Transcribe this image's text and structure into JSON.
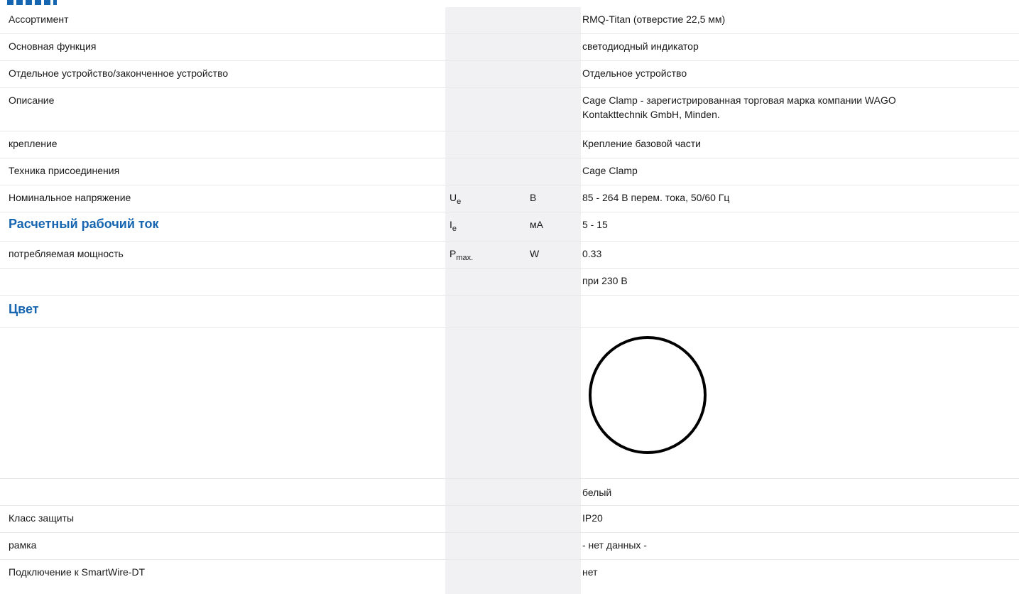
{
  "rows": [
    {
      "label": "Ассортимент",
      "value": "RMQ-Titan (отверстие 22,5 мм)"
    },
    {
      "label": "Основная функция",
      "value": "светодиодный индикатор"
    },
    {
      "label": "Отдельное устройство/законченное устройство",
      "value": "Отдельное устройство"
    },
    {
      "label": "Описание",
      "value_line1": "Cage Clamp - зарегистрированная торговая марка компании WAGO",
      "value_line2": "Kontakttechnik GmbH, Minden."
    },
    {
      "label": "крепление",
      "value": "Крепление базовой части"
    },
    {
      "label": "Техника присоединения",
      "value": "Cage Clamp"
    },
    {
      "label": "Номинальное напряжение",
      "symbol": "U",
      "symbol_sub": "e",
      "unit": "В",
      "value": "85 - 264 В перем. тока, 50/60 Гц"
    },
    {
      "label": "Расчетный рабочий ток",
      "symbol": "I",
      "symbol_sub": "e",
      "unit": "мА",
      "value": "5 - 15"
    },
    {
      "label": "потребляемая мощность",
      "symbol": "P",
      "symbol_sub": "max.",
      "unit": "W",
      "value": "0.33"
    },
    {
      "label": "",
      "value": "при 230 В"
    },
    {
      "label": "Цвет",
      "value": ""
    },
    {
      "label": "",
      "value": "",
      "icon": "color-circle-icon"
    },
    {
      "label": "",
      "value": "белый"
    },
    {
      "label": "Класс защиты",
      "value": "IP20"
    },
    {
      "label": "рамка",
      "value": "- нет данных -"
    },
    {
      "label": "Подключение к SmartWire-DT",
      "value": "нет"
    }
  ],
  "colors": {
    "heading": "#1565b0",
    "gray_column": "#f1f1f3",
    "divider": "#e8e8ea",
    "text": "#1a1a1a"
  }
}
